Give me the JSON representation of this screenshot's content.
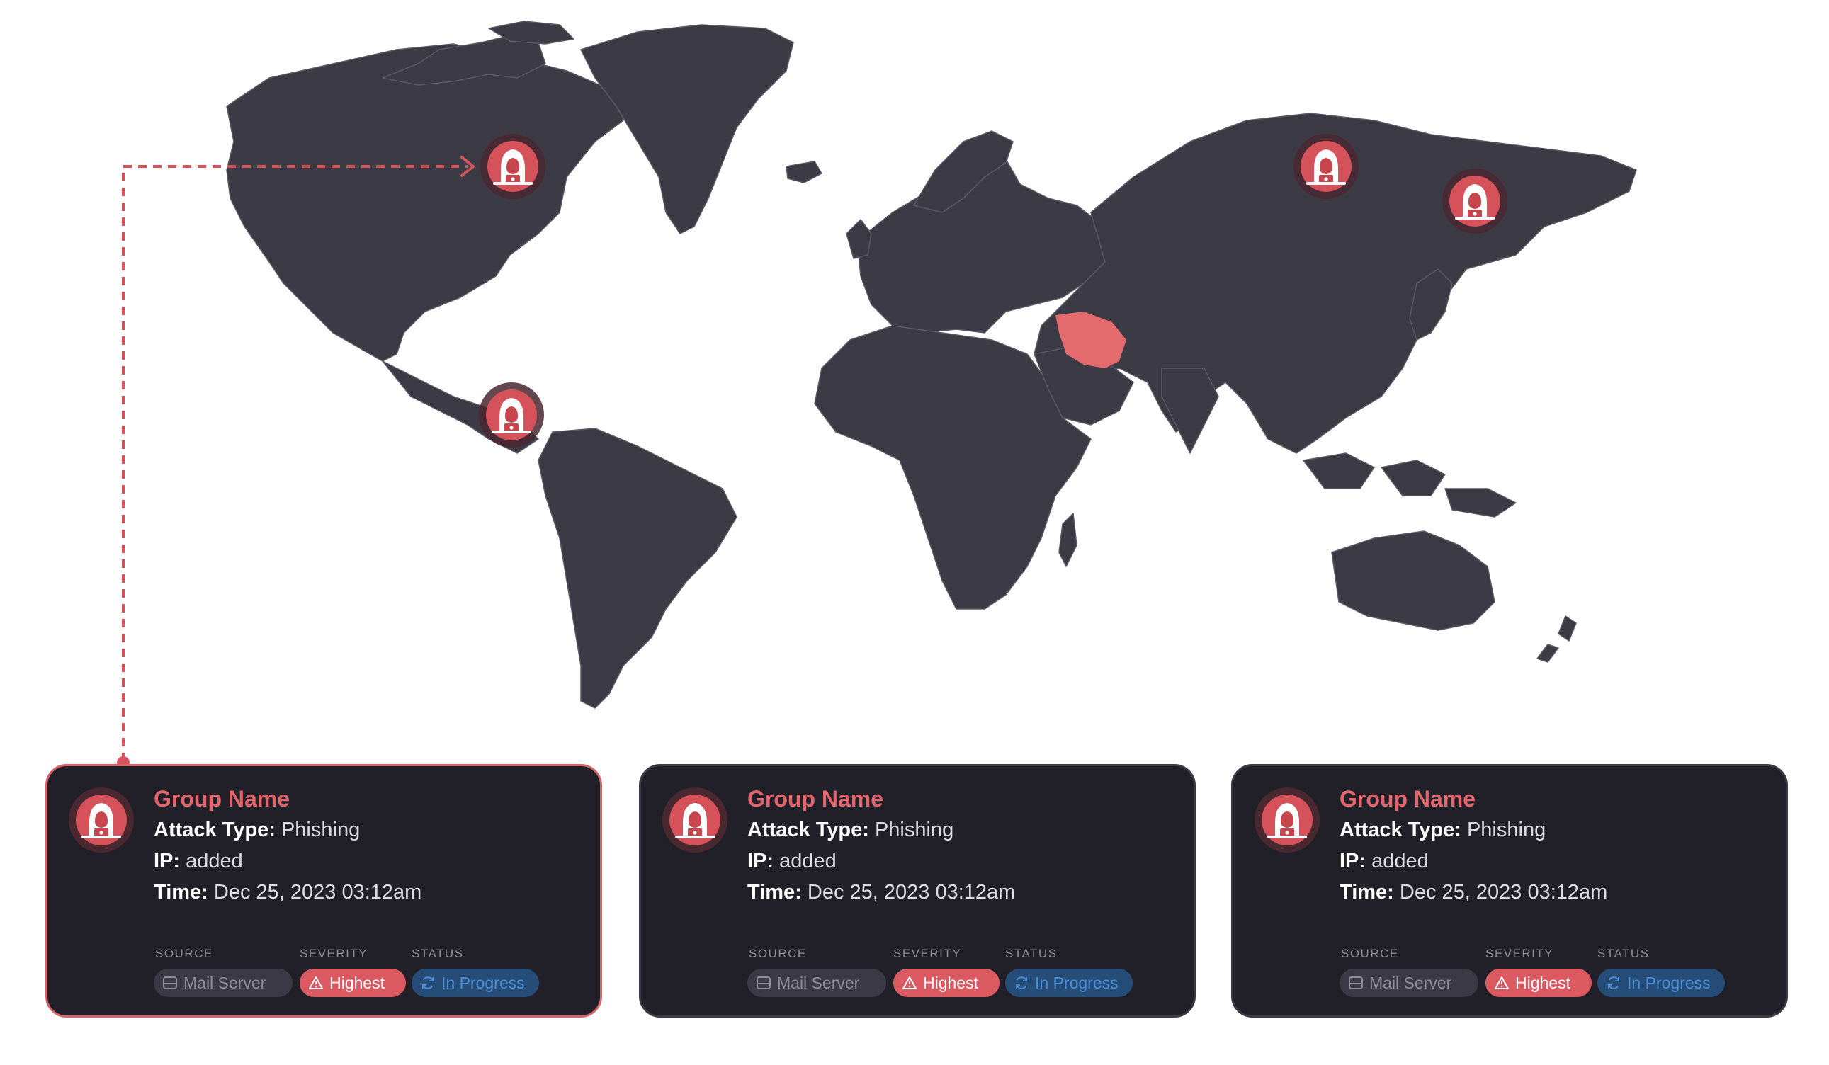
{
  "colors": {
    "land": "#3b3a45",
    "highlight_country": "#e36b6e",
    "marker": "#d6525a",
    "card_bg": "#212028",
    "accent": "#e5656c"
  },
  "map": {
    "highlighted_country": "Iran",
    "markers": [
      {
        "name": "marker-canada",
        "icon": "hacker-icon"
      },
      {
        "name": "marker-central-america",
        "icon": "hacker-icon"
      },
      {
        "name": "marker-russia-siberia",
        "icon": "hacker-icon"
      },
      {
        "name": "marker-russia-far-east",
        "icon": "hacker-icon"
      }
    ]
  },
  "labels": {
    "attack_type": "Attack Type:",
    "ip": "IP:",
    "time": "Time:",
    "source": "SOURCE",
    "severity": "SEVERITY",
    "status": "STATUS"
  },
  "cards": [
    {
      "group_name": "Group Name",
      "attack_type": "Phishing",
      "ip": "added",
      "time": "Dec 25, 2023 03:12am",
      "source": "Mail Server",
      "severity": "Highest",
      "status": "In Progress",
      "selected": true
    },
    {
      "group_name": "Group Name",
      "attack_type": "Phishing",
      "ip": "added",
      "time": "Dec 25, 2023 03:12am",
      "source": "Mail Server",
      "severity": "Highest",
      "status": "In Progress",
      "selected": false
    },
    {
      "group_name": "Group Name",
      "attack_type": "Phishing",
      "ip": "added",
      "time": "Dec 25, 2023 03:12am",
      "source": "Mail Server",
      "severity": "Highest",
      "status": "In Progress",
      "selected": false
    }
  ]
}
